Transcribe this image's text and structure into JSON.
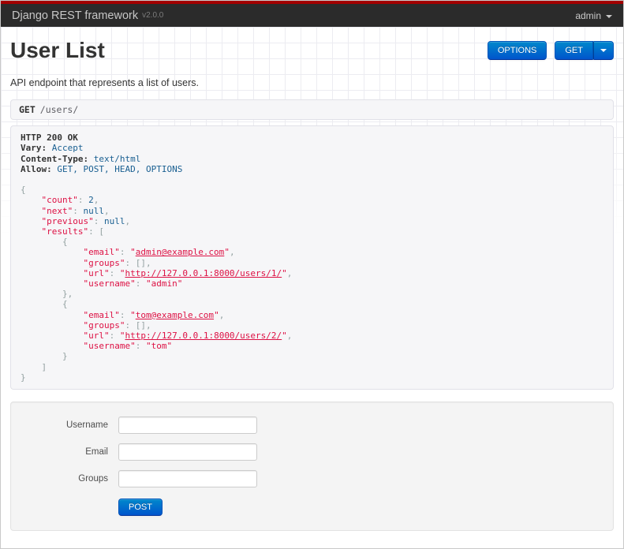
{
  "navbar": {
    "brand": "Django REST framework",
    "version": "v2.0.0",
    "user_menu": "admin"
  },
  "header": {
    "title": "User List",
    "description": "API endpoint that represents a list of users.",
    "options_button": "OPTIONS",
    "get_button": "GET"
  },
  "request": {
    "method": "GET",
    "path": "/users/"
  },
  "response": {
    "status_line": "HTTP 200 OK",
    "headers": {
      "vary": "Accept",
      "content_type": "text/html",
      "allow": "GET, POST, HEAD, OPTIONS"
    },
    "body": {
      "count": 2,
      "next": null,
      "previous": null,
      "results": [
        {
          "email": "admin@example.com",
          "groups": [],
          "url": "http://127.0.0.1:8000/users/1/",
          "username": "admin"
        },
        {
          "email": "tom@example.com",
          "groups": [],
          "url": "http://127.0.0.1:8000/users/2/",
          "username": "tom"
        }
      ]
    },
    "lines": [
      [
        [
          "nam",
          "HTTP 200 OK"
        ]
      ],
      [
        [
          "nam",
          "Vary:"
        ],
        [
          "pln",
          " "
        ],
        [
          "lit",
          "Accept"
        ]
      ],
      [
        [
          "nam",
          "Content-Type:"
        ],
        [
          "pln",
          " "
        ],
        [
          "lit",
          "text/html"
        ]
      ],
      [
        [
          "nam",
          "Allow:"
        ],
        [
          "pln",
          " "
        ],
        [
          "lit",
          "GET, POST, HEAD, OPTIONS"
        ]
      ],
      [],
      [
        [
          "pun",
          "{"
        ]
      ],
      [
        [
          "pln",
          "    "
        ],
        [
          "str",
          "\"count\""
        ],
        [
          "pun",
          ": "
        ],
        [
          "lit",
          "2"
        ],
        [
          "pun",
          ","
        ]
      ],
      [
        [
          "pln",
          "    "
        ],
        [
          "str",
          "\"next\""
        ],
        [
          "pun",
          ": "
        ],
        [
          "lit",
          "null"
        ],
        [
          "pun",
          ","
        ]
      ],
      [
        [
          "pln",
          "    "
        ],
        [
          "str",
          "\"previous\""
        ],
        [
          "pun",
          ": "
        ],
        [
          "lit",
          "null"
        ],
        [
          "pun",
          ","
        ]
      ],
      [
        [
          "pln",
          "    "
        ],
        [
          "str",
          "\"results\""
        ],
        [
          "pun",
          ": ["
        ]
      ],
      [
        [
          "pln",
          "        "
        ],
        [
          "pun",
          "{"
        ]
      ],
      [
        [
          "pln",
          "            "
        ],
        [
          "str",
          "\"email\""
        ],
        [
          "pun",
          ": "
        ],
        [
          "str",
          "\""
        ],
        [
          "lnk",
          "admin@example.com"
        ],
        [
          "str",
          "\""
        ],
        [
          "pun",
          ","
        ]
      ],
      [
        [
          "pln",
          "            "
        ],
        [
          "str",
          "\"groups\""
        ],
        [
          "pun",
          ": [],"
        ]
      ],
      [
        [
          "pln",
          "            "
        ],
        [
          "str",
          "\"url\""
        ],
        [
          "pun",
          ": "
        ],
        [
          "str",
          "\""
        ],
        [
          "lnk",
          "http://127.0.0.1:8000/users/1/"
        ],
        [
          "str",
          "\""
        ],
        [
          "pun",
          ","
        ]
      ],
      [
        [
          "pln",
          "            "
        ],
        [
          "str",
          "\"username\""
        ],
        [
          "pun",
          ": "
        ],
        [
          "str",
          "\"admin\""
        ]
      ],
      [
        [
          "pln",
          "        "
        ],
        [
          "pun",
          "},"
        ]
      ],
      [
        [
          "pln",
          "        "
        ],
        [
          "pun",
          "{"
        ]
      ],
      [
        [
          "pln",
          "            "
        ],
        [
          "str",
          "\"email\""
        ],
        [
          "pun",
          ": "
        ],
        [
          "str",
          "\""
        ],
        [
          "lnk",
          "tom@example.com"
        ],
        [
          "str",
          "\""
        ],
        [
          "pun",
          ","
        ]
      ],
      [
        [
          "pln",
          "            "
        ],
        [
          "str",
          "\"groups\""
        ],
        [
          "pun",
          ": [],"
        ]
      ],
      [
        [
          "pln",
          "            "
        ],
        [
          "str",
          "\"url\""
        ],
        [
          "pun",
          ": "
        ],
        [
          "str",
          "\""
        ],
        [
          "lnk",
          "http://127.0.0.1:8000/users/2/"
        ],
        [
          "str",
          "\""
        ],
        [
          "pun",
          ","
        ]
      ],
      [
        [
          "pln",
          "            "
        ],
        [
          "str",
          "\"username\""
        ],
        [
          "pun",
          ": "
        ],
        [
          "str",
          "\"tom\""
        ]
      ],
      [
        [
          "pln",
          "        "
        ],
        [
          "pun",
          "}"
        ]
      ],
      [
        [
          "pln",
          "    "
        ],
        [
          "pun",
          "]"
        ]
      ],
      [
        [
          "pun",
          "}"
        ]
      ]
    ]
  },
  "form": {
    "fields": [
      {
        "label": "Username",
        "value": ""
      },
      {
        "label": "Email",
        "value": ""
      },
      {
        "label": "Groups",
        "value": ""
      }
    ],
    "submit_label": "POST"
  },
  "colors": {
    "accent_blue": "#0088cc",
    "navbar_background": "#2b2b2b",
    "navbar_top_border": "#a20000",
    "json_string": "#dd1144",
    "json_literal": "#195f91",
    "json_punctuation": "#93a1a1",
    "panel_background": "#f6f6f8"
  }
}
